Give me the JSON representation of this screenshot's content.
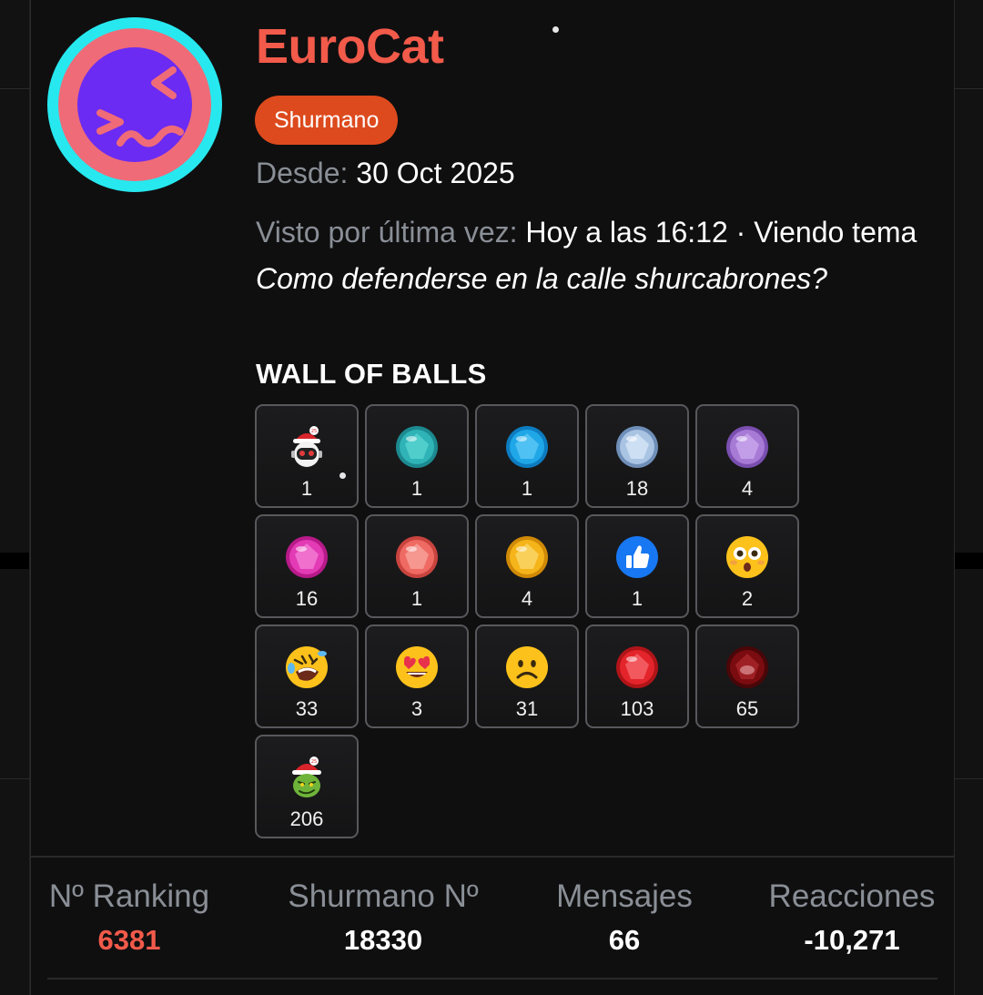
{
  "profile": {
    "username": "EuroCat",
    "role_badge": "Shurmano",
    "since_label": "Desde:",
    "since_value": "30 Oct 2025",
    "last_seen_label": "Visto por última vez:",
    "last_seen_value": "Hoy a las 16:12 · Viendo tema",
    "last_seen_thread": "Como defenderse en la calle shurcabrones?"
  },
  "wall": {
    "title": "WALL OF BALLS",
    "items": [
      {
        "icon": "santa-robot-icon",
        "count": "1"
      },
      {
        "icon": "teal-gem-icon",
        "count": "1"
      },
      {
        "icon": "blue-gem-icon",
        "count": "1"
      },
      {
        "icon": "silver-gem-icon",
        "count": "18"
      },
      {
        "icon": "purple-gem-icon",
        "count": "4"
      },
      {
        "icon": "pink-gem-icon",
        "count": "16"
      },
      {
        "icon": "salmon-gem-icon",
        "count": "1"
      },
      {
        "icon": "gold-gem-icon",
        "count": "4"
      },
      {
        "icon": "thumbs-up-icon",
        "count": "1"
      },
      {
        "icon": "flushed-face-icon",
        "count": "2"
      },
      {
        "icon": "rolling-laughing-face-icon",
        "count": "33"
      },
      {
        "icon": "heart-eyes-face-icon",
        "count": "3"
      },
      {
        "icon": "frowning-face-icon",
        "count": "31"
      },
      {
        "icon": "red-gem-icon",
        "count": "103"
      },
      {
        "icon": "dark-red-gem-icon",
        "count": "65"
      },
      {
        "icon": "santa-grinch-icon",
        "count": "206"
      }
    ]
  },
  "stats": [
    {
      "label": "Nº Ranking",
      "value": "6381"
    },
    {
      "label": "Shurmano Nº",
      "value": "18330"
    },
    {
      "label": "Mensajes",
      "value": "66"
    },
    {
      "label": "Reacciones",
      "value": "-10,271"
    }
  ],
  "colors": {
    "username": "#f25a4a",
    "badge": "#dd4a1d",
    "ranking_value": "#f25a4a",
    "avatar_outer": "#27e8ef",
    "avatar_ring": "#ef6b78",
    "avatar_inner": "#6b2bf2"
  }
}
